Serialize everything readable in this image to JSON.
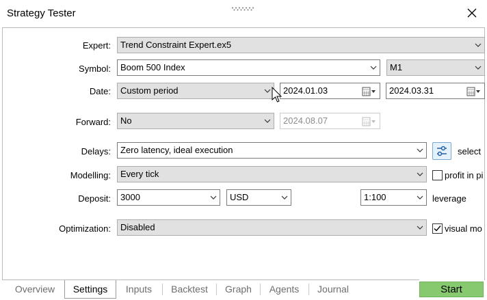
{
  "window": {
    "title": "Strategy Tester"
  },
  "labels": {
    "expert": "Expert:",
    "symbol": "Symbol:",
    "date": "Date:",
    "forward": "Forward:",
    "delays": "Delays:",
    "modelling": "Modelling:",
    "deposit": "Deposit:",
    "optimization": "Optimization:"
  },
  "fields": {
    "expert": "Trend Constraint Expert.ex5",
    "symbol": "Boom 500 Index",
    "timeframe": "M1",
    "date_mode": "Custom period",
    "date_from": "2024.01.03",
    "date_to": "2024.03.31",
    "forward": "No",
    "forward_date": "2024.08.07",
    "delays": "Zero latency, ideal execution",
    "modelling": "Every tick",
    "deposit": "3000",
    "currency": "USD",
    "leverage": "1:100",
    "optimization": "Disabled"
  },
  "side": {
    "select": "select",
    "profit_in_pips": "profit in pi",
    "profit_in_pips_checked": false,
    "leverage_label": "leverage",
    "visual_mode": "visual mo",
    "visual_mode_checked": true
  },
  "tabs": [
    "Overview",
    "Settings",
    "Inputs",
    "Backtest",
    "Graph",
    "Agents",
    "Journal"
  ],
  "active_tab": "Settings",
  "start_label": "Start",
  "colors": {
    "start_button": "#86c96f",
    "combo_bg": "#e1e1e1"
  }
}
